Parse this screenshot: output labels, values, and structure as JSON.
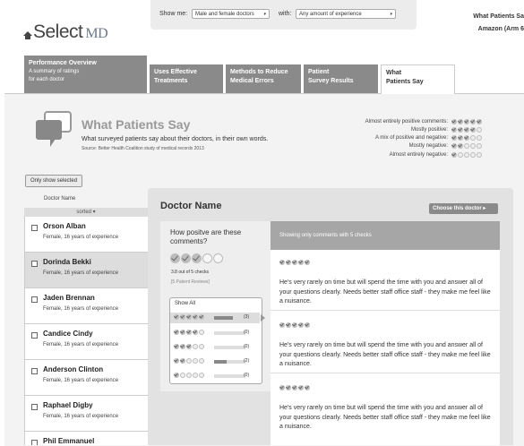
{
  "header": {
    "logo_text": "Select",
    "logo_suffix": "MD",
    "right_line1": "What Patients Sa",
    "right_line2": "Amazon (Arm 6"
  },
  "filters": {
    "show_me_label": "Show me:",
    "show_me_value": "Male and female doctors",
    "with_label": "with:",
    "with_value": "Any amount of experience"
  },
  "tabs": [
    {
      "title": "Performance Overview",
      "sub1": "A summary of ratings",
      "sub2": "for each doctor"
    },
    {
      "title1": "Uses Effective",
      "title2": "Treatments"
    },
    {
      "title1": "Methods to Reduce",
      "title2": "Medical Errors"
    },
    {
      "title1": "Patient",
      "title2": "Survey Results"
    },
    {
      "title1": "What",
      "title2": "Patients Say"
    }
  ],
  "section": {
    "title": "What Patients Say",
    "description": "What surveyed patients say about their doctors, in their own words.",
    "source": "Source: Better Health Coalition study of medical records 2013"
  },
  "legend": [
    {
      "label": "Almost entirely positive comments:",
      "checks": 5
    },
    {
      "label": "Mostly positive:",
      "checks": 4
    },
    {
      "label": "A mix of positive and negative:",
      "checks": 3
    },
    {
      "label": "Mostly negative:",
      "checks": 2
    },
    {
      "label": "Almost entirely negative:",
      "checks": 1
    }
  ],
  "list": {
    "only_show_selected": "Only show selected",
    "column_header": "Doctor Name",
    "sorted_label": "sorted ▾",
    "doctors": [
      {
        "name": "Orson Alban",
        "info": "Female, 16 years of experience"
      },
      {
        "name": "Dorinda Bekki",
        "info": "Female, 16 years of experience"
      },
      {
        "name": "Jaden Brennan",
        "info": "Female, 16 years of experience"
      },
      {
        "name": "Candice Cindy",
        "info": "Female, 16 years of experience"
      },
      {
        "name": "Anderson Clinton",
        "info": "Female, 16 years of experience"
      },
      {
        "name": "Raphael Digby",
        "info": "Female, 16 years of experience"
      },
      {
        "name": "Phil Emmanuel",
        "info": ""
      }
    ]
  },
  "doctor": {
    "name": "Doctor Name",
    "choose_button": "Choose this doctor ▸",
    "question": "How positve are these comments?",
    "big_checks": 3,
    "score_text": "3.8 out of 5 checks",
    "reviews_text": "[5 Patient Reviews]",
    "show_all": "Show All",
    "distribution": [
      {
        "checks": 5,
        "count": "(3)",
        "fraction": 0.6
      },
      {
        "checks": 4,
        "count": "(0)",
        "fraction": 0
      },
      {
        "checks": 3,
        "count": "(0)",
        "fraction": 0
      },
      {
        "checks": 2,
        "count": "(2)",
        "fraction": 0.4
      },
      {
        "checks": 1,
        "count": "(0)",
        "fraction": 0
      }
    ],
    "comments_header": "Showing only comments with 5 checks",
    "comments": [
      {
        "checks": 5,
        "text": "He's very rarely on time but will spend the time with you and answer all of your questions clearly. Needs better staff office staff - they make me feel like a nuisance."
      },
      {
        "checks": 5,
        "text": "He's very rarely on time but will spend the time with you and answer all of your questions clearly. Needs better staff office staff - they make me feel like a nuisance."
      },
      {
        "checks": 5,
        "text": "He's very rarely on time but will spend the time with you and answer all of your questions clearly. Needs better staff office staff - they make me feel like a nuisance."
      }
    ]
  }
}
